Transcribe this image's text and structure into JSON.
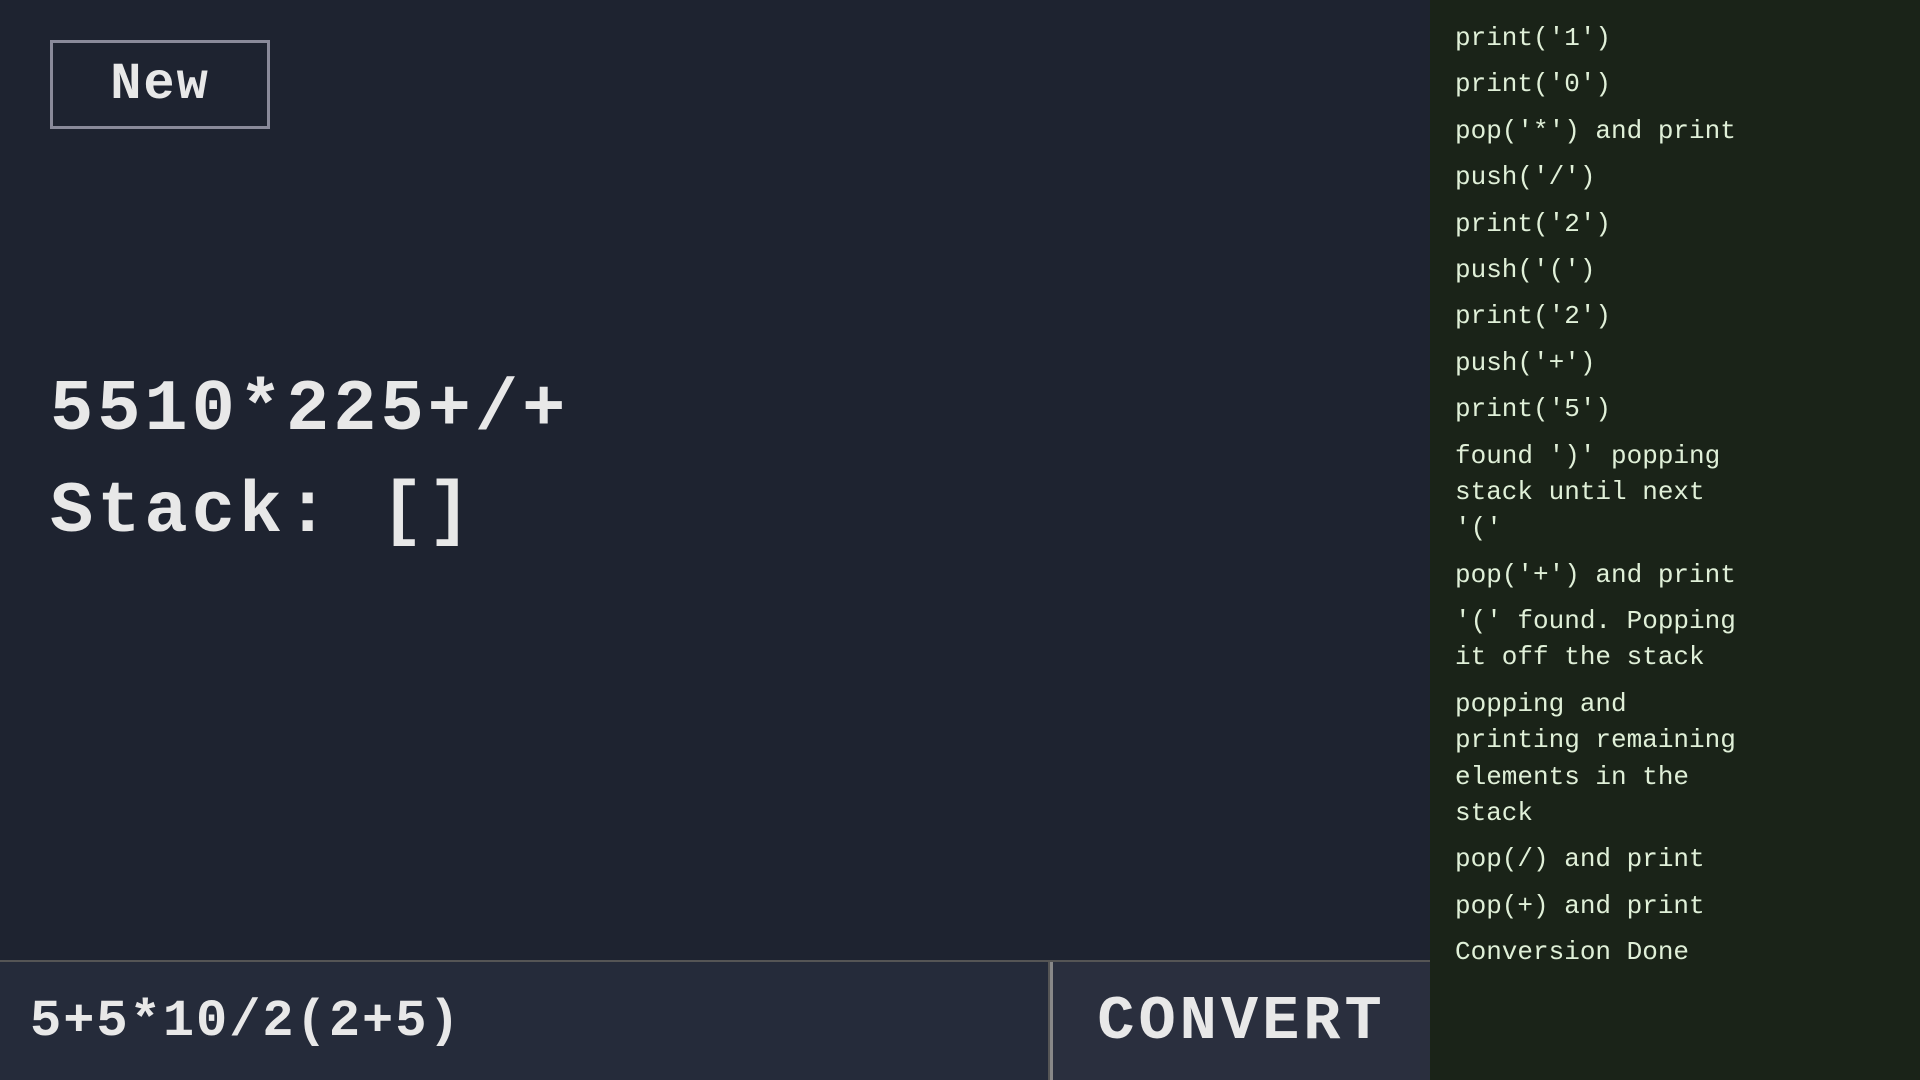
{
  "new_button": {
    "label": "New"
  },
  "main": {
    "output_expression": "5510*225+/+",
    "stack_display": "Stack:  []"
  },
  "bottom": {
    "input_value": "5+5*10/2(2+5)",
    "convert_label": "CONVERT"
  },
  "log": {
    "entries": [
      "print('1')",
      "print('0')",
      "pop('*') and print",
      "push('/')",
      "print('2')",
      "push('(')",
      "print('2')",
      "push('+')",
      "print('5')",
      "found ')' popping\nstack until next\n'('",
      "pop('+') and print",
      "'(' found. Popping\nit off the stack",
      "popping and\nprinting remaining\nelements in the\nstack",
      "pop(/) and print",
      "pop(+) and print",
      "Conversion Done"
    ]
  }
}
